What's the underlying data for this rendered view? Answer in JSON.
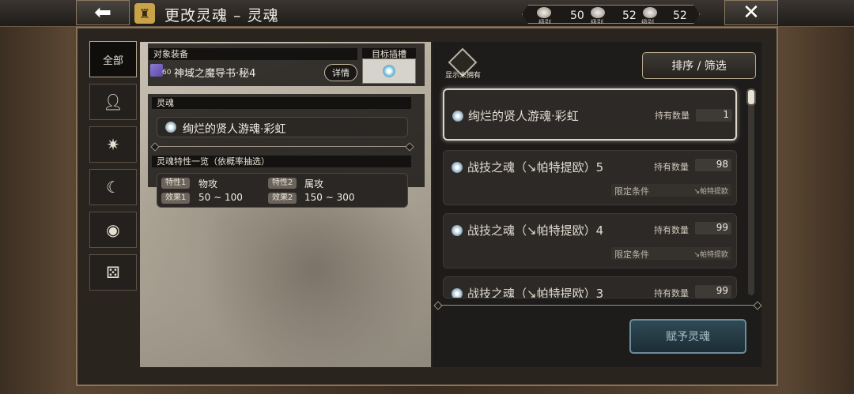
{
  "header": {
    "back_icon": "arrow-left-icon",
    "close_icon": "close-icon",
    "title": "更改灵魂 – 灵魂",
    "currencies": [
      {
        "value": "50",
        "caption": "级别"
      },
      {
        "value": "52",
        "caption": "级别"
      },
      {
        "value": "52",
        "caption": "级别"
      }
    ]
  },
  "nav": {
    "items": [
      {
        "label": "全部",
        "icon": "all"
      },
      {
        "label": "",
        "icon": "person-icon"
      },
      {
        "label": "",
        "icon": "sparkle-icon"
      },
      {
        "label": "",
        "icon": "moon-icon"
      },
      {
        "label": "",
        "icon": "target-icon"
      },
      {
        "label": "",
        "icon": "dice-icon"
      }
    ]
  },
  "left": {
    "target_header": "对象装备",
    "slot_header": "目标插槽",
    "item_level": "60",
    "item_name": "神域之魔导书·秘4",
    "detail_label": "详情",
    "soul_header": "灵魂",
    "soul_name": "绚烂的贤人游魂·彩虹",
    "traits_header": "灵魂特性一览（依概率抽选）",
    "trait1_tag": "特性1",
    "trait1_value": "物攻",
    "trait2_tag": "特性2",
    "trait2_value": "属攻",
    "effect1_tag": "效果1",
    "effect1_value": "50 ~ 100",
    "effect2_tag": "效果2",
    "effect2_value": "150 ~ 300"
  },
  "right": {
    "filter_label": "显示未拥有",
    "sort_label": "排序 / 筛选",
    "qty_label": "持有数量",
    "cond_label": "限定条件",
    "cards": [
      {
        "name": "绚烂的贤人游魂·彩虹",
        "qty": "1",
        "cond": ""
      },
      {
        "name": "战技之魂（↘帕特提欧）5",
        "qty": "98",
        "cond": "↘帕特提欧"
      },
      {
        "name": "战技之魂（↘帕特提欧）4",
        "qty": "99",
        "cond": "↘帕特提欧"
      },
      {
        "name": "战技之魂（↘帕特提欧）3",
        "qty": "99",
        "cond": ""
      }
    ],
    "grant_label": "赋予灵魂"
  }
}
